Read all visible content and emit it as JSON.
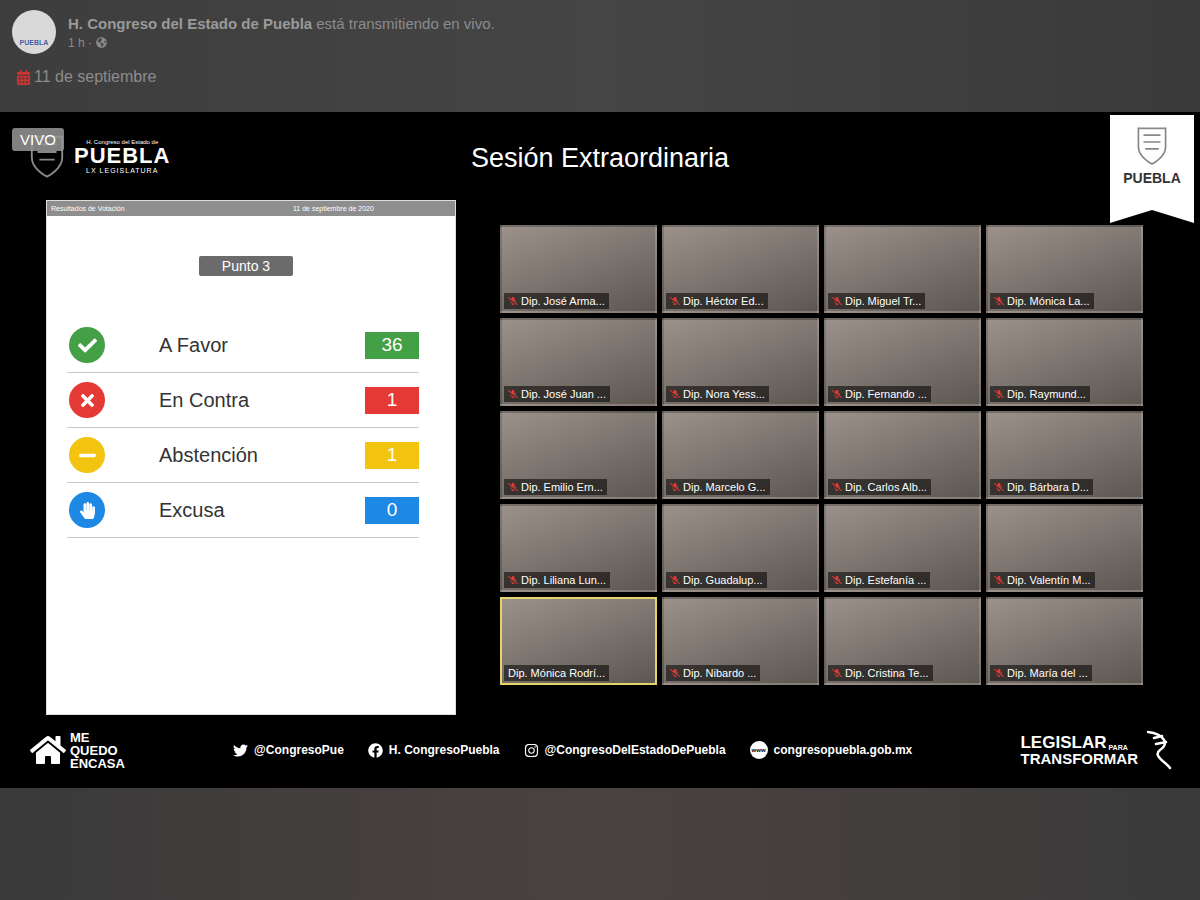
{
  "post": {
    "avatar_text": "PUEBLA",
    "author": "H. Congreso del Estado de Puebla",
    "action": "está transmitiendo en vivo.",
    "time": "1 h ·",
    "date": "11 de septiembre"
  },
  "video": {
    "live_badge": "VIVO",
    "logo": {
      "top": "H. Congreso del Estado de",
      "name": "PUEBLA",
      "sub": "LX LEGISLATURA"
    },
    "title": "Sesión Extraordinaria",
    "corner_badge": "PUEBLA",
    "results": {
      "header": "Resultados de Votación",
      "date": "11 de septiembre de 2020",
      "item": "Punto 3",
      "rows": [
        {
          "kind": "check",
          "label": "A Favor",
          "count": "36",
          "color": "#43a047"
        },
        {
          "kind": "cross",
          "label": "En Contra",
          "count": "1",
          "color": "#e53935"
        },
        {
          "kind": "minus",
          "label": "Abstención",
          "count": "1",
          "color": "#f2c40f"
        },
        {
          "kind": "hand",
          "label": "Excusa",
          "count": "0",
          "color": "#1e88e5"
        }
      ]
    },
    "participants": [
      {
        "name": "Dip. José Arma...",
        "selected": false,
        "muted": true
      },
      {
        "name": "Dip. Héctor Ed...",
        "selected": false,
        "muted": true
      },
      {
        "name": "Dip. Miguel Tr...",
        "selected": false,
        "muted": true
      },
      {
        "name": "Dip. Mónica La...",
        "selected": false,
        "muted": true
      },
      {
        "name": "Dip. José Juan ...",
        "selected": false,
        "muted": true
      },
      {
        "name": "Dip. Nora Yess...",
        "selected": false,
        "muted": true
      },
      {
        "name": "Dip. Fernando ...",
        "selected": false,
        "muted": true
      },
      {
        "name": "Dip. Raymund...",
        "selected": false,
        "muted": true
      },
      {
        "name": "Dip. Emilio Ern...",
        "selected": false,
        "muted": true
      },
      {
        "name": "Dip. Marcelo G...",
        "selected": false,
        "muted": true
      },
      {
        "name": "Dip. Carlos Alb...",
        "selected": false,
        "muted": true
      },
      {
        "name": "Dip. Bárbara D...",
        "selected": false,
        "muted": true
      },
      {
        "name": "Dip. Liliana Lun...",
        "selected": false,
        "muted": true
      },
      {
        "name": "Dip. Guadalup...",
        "selected": false,
        "muted": true
      },
      {
        "name": "Dip. Estefanía ...",
        "selected": false,
        "muted": true
      },
      {
        "name": "Dip. Valentín M...",
        "selected": false,
        "muted": true
      },
      {
        "name": "Dip. Mónica Rodrí...",
        "selected": true,
        "muted": false
      },
      {
        "name": "Dip. Nibardo ...",
        "selected": false,
        "muted": true
      },
      {
        "name": "Dip. Cristina Te...",
        "selected": false,
        "muted": true
      },
      {
        "name": "Dip. María del ...",
        "selected": false,
        "muted": true
      }
    ],
    "footer": {
      "campaign": [
        "ME",
        "QUEDO",
        "ENCASA"
      ],
      "socials": [
        {
          "kind": "twitter",
          "label": "@CongresoPue"
        },
        {
          "kind": "facebook",
          "label": "H. CongresoPuebla"
        },
        {
          "kind": "instagram",
          "label": "@CongresoDelEstadoDePuebla"
        },
        {
          "kind": "web",
          "label": "congresopuebla.gob.mx",
          "badge": "www"
        }
      ],
      "slogan": {
        "top": "LEGISLAR",
        "small": "PARA",
        "bottom": "TRANSFORMAR"
      }
    }
  }
}
